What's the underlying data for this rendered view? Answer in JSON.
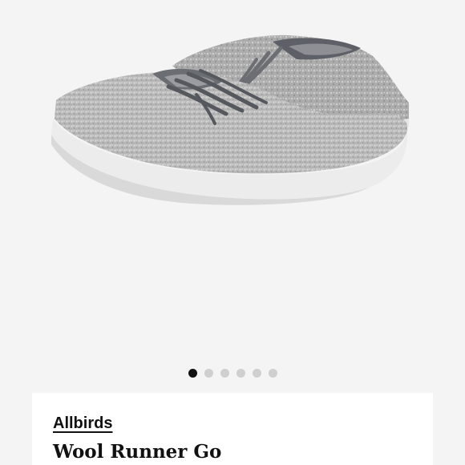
{
  "product": {
    "brand": "Allbirds",
    "name": "Wool Runner Go"
  },
  "gallery": {
    "image_count": 6,
    "active_index": 0
  },
  "colors": {
    "background": "#f4f4f4",
    "card": "#ffffff",
    "dot_active": "#111111",
    "dot_inactive": "#cfcfcf"
  }
}
